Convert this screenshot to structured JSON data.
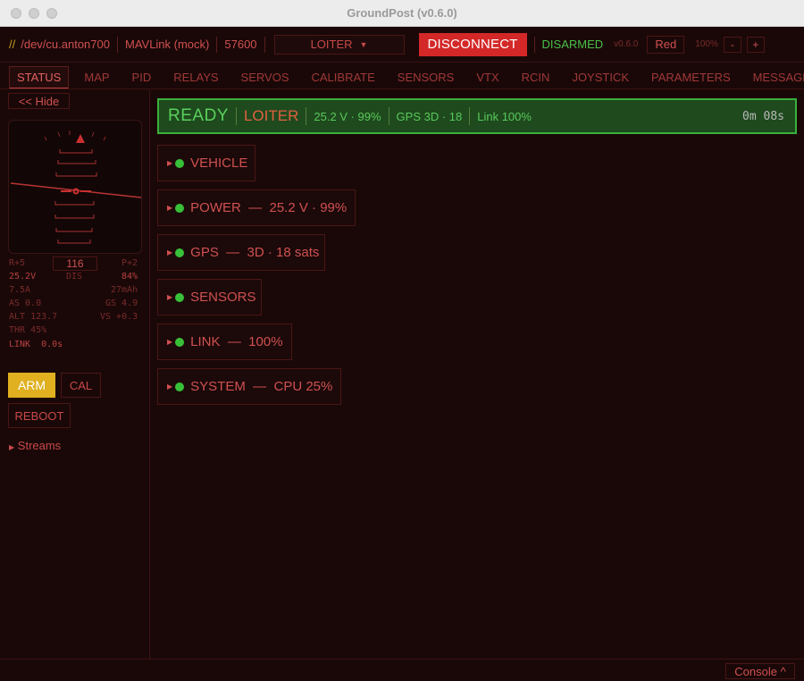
{
  "window": {
    "title": "GroundPost (v0.6.0)"
  },
  "topbar": {
    "slash": "//",
    "port": "/dev/cu.anton700",
    "link": "MAVLink (mock)",
    "baud": "57600",
    "mode": "LOITER",
    "disconnect_label": "DISCONNECT",
    "armed_state": "DISARMED",
    "version": "v0.6.0",
    "theme": "Red",
    "zoom": "100%",
    "zoom_out": "-",
    "zoom_in": "+"
  },
  "tabs": [
    "STATUS",
    "MAP",
    "PID",
    "RELAYS",
    "SERVOS",
    "CALIBRATE",
    "SENSORS",
    "VTX",
    "RCIN",
    "JOYSTICK",
    "PARAMETERS",
    "MESSAGES"
  ],
  "sidebar": {
    "hide_label": "<< Hide",
    "hud": {
      "roll": "R+5",
      "heading": "116",
      "pitch": "P+2",
      "voltage": "25.2V",
      "dis": "DIS",
      "battery": "84%",
      "current": "7.5A",
      "mah": "27mAh",
      "airspeed": "AS 0.0",
      "groundspeed": "GS 4.9",
      "altitude": "ALT 123.7",
      "vspeed": "VS +0.3",
      "throttle": "THR 45%",
      "link": "LINK  0.0s"
    },
    "arm_label": "ARM",
    "cal_label": "CAL",
    "reboot_label": "REBOOT",
    "streams_label": "Streams"
  },
  "banner": {
    "state": "READY",
    "mode": "LOITER",
    "power": "25.2 V · 99%",
    "gps": "GPS 3D · 18",
    "link": "Link 100%",
    "time": "0m 08s"
  },
  "panels": [
    {
      "label": "VEHICLE"
    },
    {
      "label": "POWER  —  25.2 V · 99%"
    },
    {
      "label": "GPS  —  3D · 18 sats"
    },
    {
      "label": "SENSORS"
    },
    {
      "label": "LINK  —  100%"
    },
    {
      "label": "SYSTEM  —  CPU 25%"
    }
  ],
  "console_label": "Console ^",
  "colors": {
    "background": "#1a0808",
    "accent": "#c04040",
    "disconnect": "#d42828",
    "ready": "#5ad05a",
    "arm": "#e0b020"
  }
}
